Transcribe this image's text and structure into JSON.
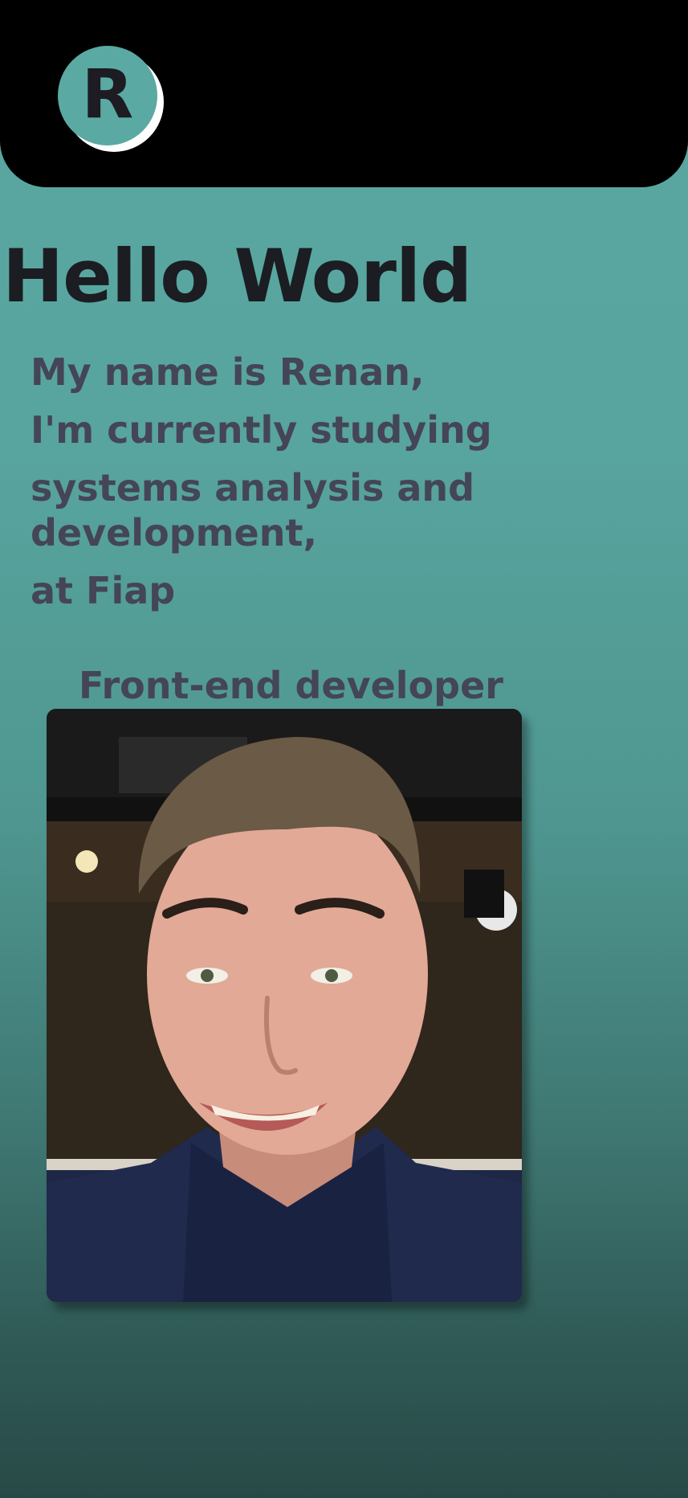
{
  "header": {
    "logo_letter": "R"
  },
  "hero": {
    "title": "Hello World",
    "intro_lines": [
      "My name is Renan,",
      "I'm currently studying",
      "systems analysis and",
      "development,",
      "at Fiap"
    ],
    "role": "Front-end developer"
  },
  "photo": {
    "description_name": "profile-photo"
  },
  "colors": {
    "header_bg": "#000000",
    "logo_bg": "#5ba9a3",
    "page_gradient_top": "#5aa8a2",
    "page_gradient_bottom": "#284a47",
    "title_text": "#1b1d22",
    "body_text": "#444556"
  }
}
